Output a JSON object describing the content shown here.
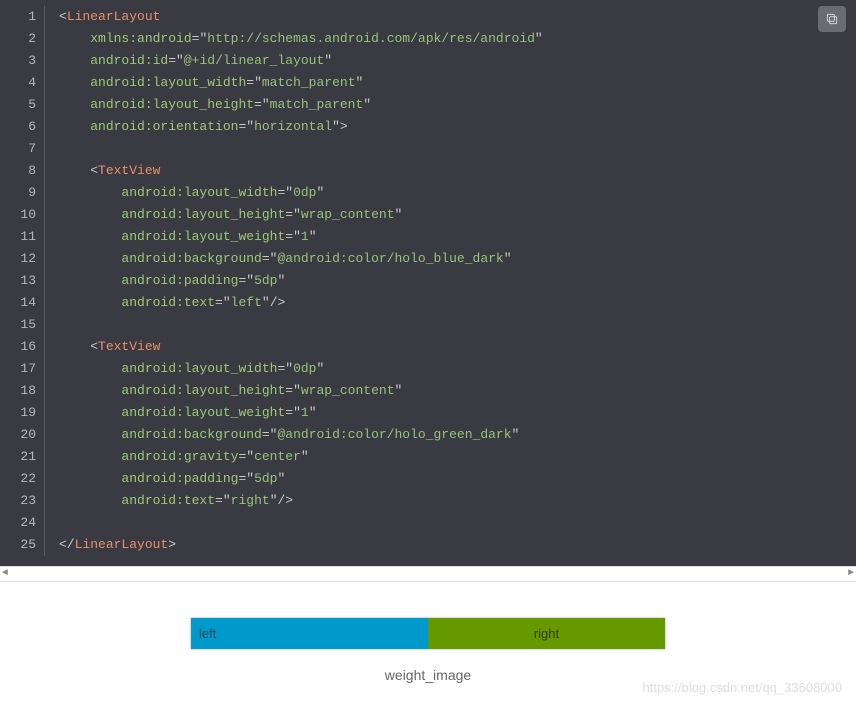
{
  "code": {
    "lines": [
      {
        "n": "1",
        "segs": [
          {
            "c": "lt",
            "t": "<"
          },
          {
            "c": "tag",
            "t": "LinearLayout"
          }
        ]
      },
      {
        "n": "2",
        "segs": [
          {
            "c": "",
            "t": "    "
          },
          {
            "c": "attr",
            "t": "xmlns:android"
          },
          {
            "c": "lt",
            "t": "="
          },
          {
            "c": "lt",
            "t": "\""
          },
          {
            "c": "strval",
            "t": "http://schemas.android.com/apk/res/android"
          },
          {
            "c": "lt",
            "t": "\""
          }
        ]
      },
      {
        "n": "3",
        "segs": [
          {
            "c": "",
            "t": "    "
          },
          {
            "c": "attr",
            "t": "android:id"
          },
          {
            "c": "lt",
            "t": "="
          },
          {
            "c": "lt",
            "t": "\""
          },
          {
            "c": "strval",
            "t": "@+id/linear_layout"
          },
          {
            "c": "lt",
            "t": "\""
          }
        ]
      },
      {
        "n": "4",
        "segs": [
          {
            "c": "",
            "t": "    "
          },
          {
            "c": "attr",
            "t": "android:layout_width"
          },
          {
            "c": "lt",
            "t": "="
          },
          {
            "c": "lt",
            "t": "\""
          },
          {
            "c": "strval",
            "t": "match_parent"
          },
          {
            "c": "lt",
            "t": "\""
          }
        ]
      },
      {
        "n": "5",
        "segs": [
          {
            "c": "",
            "t": "    "
          },
          {
            "c": "attr",
            "t": "android:layout_height"
          },
          {
            "c": "lt",
            "t": "="
          },
          {
            "c": "lt",
            "t": "\""
          },
          {
            "c": "strval",
            "t": "match_parent"
          },
          {
            "c": "lt",
            "t": "\""
          }
        ]
      },
      {
        "n": "6",
        "segs": [
          {
            "c": "",
            "t": "    "
          },
          {
            "c": "attr",
            "t": "android:orientation"
          },
          {
            "c": "lt",
            "t": "="
          },
          {
            "c": "lt",
            "t": "\""
          },
          {
            "c": "strval",
            "t": "horizontal"
          },
          {
            "c": "lt",
            "t": "\">"
          }
        ]
      },
      {
        "n": "7",
        "segs": []
      },
      {
        "n": "8",
        "segs": [
          {
            "c": "",
            "t": "    "
          },
          {
            "c": "lt",
            "t": "<"
          },
          {
            "c": "tag",
            "t": "TextView"
          }
        ]
      },
      {
        "n": "9",
        "segs": [
          {
            "c": "",
            "t": "        "
          },
          {
            "c": "attr",
            "t": "android:layout_width"
          },
          {
            "c": "lt",
            "t": "="
          },
          {
            "c": "lt",
            "t": "\""
          },
          {
            "c": "strval",
            "t": "0dp"
          },
          {
            "c": "lt",
            "t": "\""
          }
        ]
      },
      {
        "n": "10",
        "segs": [
          {
            "c": "",
            "t": "        "
          },
          {
            "c": "attr",
            "t": "android:layout_height"
          },
          {
            "c": "lt",
            "t": "="
          },
          {
            "c": "lt",
            "t": "\""
          },
          {
            "c": "strval",
            "t": "wrap_content"
          },
          {
            "c": "lt",
            "t": "\""
          }
        ]
      },
      {
        "n": "11",
        "segs": [
          {
            "c": "",
            "t": "        "
          },
          {
            "c": "attr",
            "t": "android:layout_weight"
          },
          {
            "c": "lt",
            "t": "="
          },
          {
            "c": "lt",
            "t": "\""
          },
          {
            "c": "strval",
            "t": "1"
          },
          {
            "c": "lt",
            "t": "\""
          }
        ]
      },
      {
        "n": "12",
        "segs": [
          {
            "c": "",
            "t": "        "
          },
          {
            "c": "attr",
            "t": "android:background"
          },
          {
            "c": "lt",
            "t": "="
          },
          {
            "c": "lt",
            "t": "\""
          },
          {
            "c": "strval",
            "t": "@android:color/holo_blue_dark"
          },
          {
            "c": "lt",
            "t": "\""
          }
        ]
      },
      {
        "n": "13",
        "segs": [
          {
            "c": "",
            "t": "        "
          },
          {
            "c": "attr",
            "t": "android:padding"
          },
          {
            "c": "lt",
            "t": "="
          },
          {
            "c": "lt",
            "t": "\""
          },
          {
            "c": "strval",
            "t": "5dp"
          },
          {
            "c": "lt",
            "t": "\""
          }
        ]
      },
      {
        "n": "14",
        "segs": [
          {
            "c": "",
            "t": "        "
          },
          {
            "c": "attr",
            "t": "android:text"
          },
          {
            "c": "lt",
            "t": "="
          },
          {
            "c": "lt",
            "t": "\""
          },
          {
            "c": "strval",
            "t": "left"
          },
          {
            "c": "lt",
            "t": "\"/>"
          }
        ]
      },
      {
        "n": "15",
        "segs": []
      },
      {
        "n": "16",
        "segs": [
          {
            "c": "",
            "t": "    "
          },
          {
            "c": "lt",
            "t": "<"
          },
          {
            "c": "tag",
            "t": "TextView"
          }
        ]
      },
      {
        "n": "17",
        "segs": [
          {
            "c": "",
            "t": "        "
          },
          {
            "c": "attr",
            "t": "android:layout_width"
          },
          {
            "c": "lt",
            "t": "="
          },
          {
            "c": "lt",
            "t": "\""
          },
          {
            "c": "strval",
            "t": "0dp"
          },
          {
            "c": "lt",
            "t": "\""
          }
        ]
      },
      {
        "n": "18",
        "segs": [
          {
            "c": "",
            "t": "        "
          },
          {
            "c": "attr",
            "t": "android:layout_height"
          },
          {
            "c": "lt",
            "t": "="
          },
          {
            "c": "lt",
            "t": "\""
          },
          {
            "c": "strval",
            "t": "wrap_content"
          },
          {
            "c": "lt",
            "t": "\""
          }
        ]
      },
      {
        "n": "19",
        "segs": [
          {
            "c": "",
            "t": "        "
          },
          {
            "c": "attr",
            "t": "android:layout_weight"
          },
          {
            "c": "lt",
            "t": "="
          },
          {
            "c": "lt",
            "t": "\""
          },
          {
            "c": "strval",
            "t": "1"
          },
          {
            "c": "lt",
            "t": "\""
          }
        ]
      },
      {
        "n": "20",
        "segs": [
          {
            "c": "",
            "t": "        "
          },
          {
            "c": "attr",
            "t": "android:background"
          },
          {
            "c": "lt",
            "t": "="
          },
          {
            "c": "lt",
            "t": "\""
          },
          {
            "c": "strval",
            "t": "@android:color/holo_green_dark"
          },
          {
            "c": "lt",
            "t": "\""
          }
        ]
      },
      {
        "n": "21",
        "segs": [
          {
            "c": "",
            "t": "        "
          },
          {
            "c": "attr",
            "t": "android:gravity"
          },
          {
            "c": "lt",
            "t": "="
          },
          {
            "c": "lt",
            "t": "\""
          },
          {
            "c": "strval",
            "t": "center"
          },
          {
            "c": "lt",
            "t": "\""
          }
        ]
      },
      {
        "n": "22",
        "segs": [
          {
            "c": "",
            "t": "        "
          },
          {
            "c": "attr",
            "t": "android:padding"
          },
          {
            "c": "lt",
            "t": "="
          },
          {
            "c": "lt",
            "t": "\""
          },
          {
            "c": "strval",
            "t": "5dp"
          },
          {
            "c": "lt",
            "t": "\""
          }
        ]
      },
      {
        "n": "23",
        "segs": [
          {
            "c": "",
            "t": "        "
          },
          {
            "c": "attr",
            "t": "android:text"
          },
          {
            "c": "lt",
            "t": "="
          },
          {
            "c": "lt",
            "t": "\""
          },
          {
            "c": "strval",
            "t": "right"
          },
          {
            "c": "lt",
            "t": "\"/>"
          }
        ]
      },
      {
        "n": "24",
        "segs": []
      },
      {
        "n": "25",
        "segs": [
          {
            "c": "lt",
            "t": "</"
          },
          {
            "c": "tag",
            "t": "LinearLayout"
          },
          {
            "c": "lt",
            "t": ">"
          }
        ]
      }
    ]
  },
  "preview": {
    "left_text": "left",
    "right_text": "right",
    "caption": "weight_image"
  },
  "watermark": "https://blog.csdn.net/qq_33608000"
}
